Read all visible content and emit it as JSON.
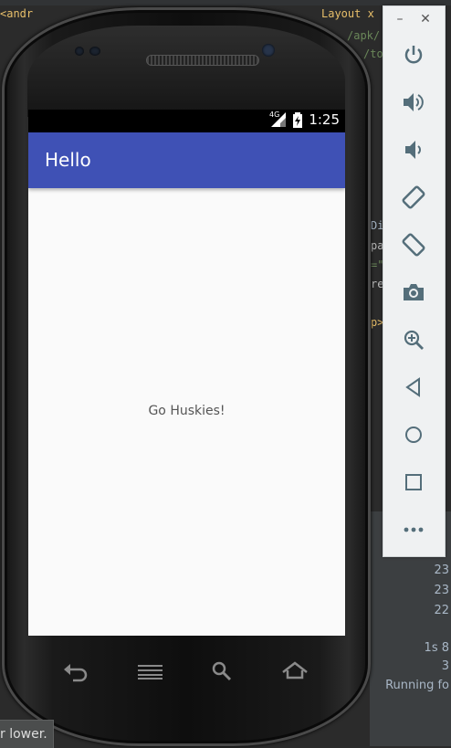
{
  "ide": {
    "code_line_1": "<andr",
    "code_line_1b": "Layout x",
    "code_frag_apk": "/apk/",
    "code_frag_to": "/to",
    "right_frags": [
      "Di",
      "pa",
      "=\"",
      "re",
      "p>"
    ],
    "log_lines": [
      "23",
      "23",
      "22",
      "1s 8",
      "3",
      "Running fo"
    ],
    "status_tip": "r lower."
  },
  "phone": {
    "status_bar": {
      "network": "4G",
      "time": "1:25"
    },
    "app_bar": {
      "title": "Hello"
    },
    "content": {
      "message": "Go Huskies!"
    },
    "nav_buttons": [
      "back-icon",
      "menu-icon",
      "search-icon",
      "home-icon"
    ]
  },
  "emulator_toolbar": {
    "window_controls": {
      "minimize": "–",
      "close": "✕"
    },
    "buttons": [
      "power-icon",
      "volume-up-icon",
      "volume-down-icon",
      "rotate-left-icon",
      "rotate-right-icon",
      "camera-icon",
      "zoom-icon",
      "back-icon",
      "home-icon",
      "overview-icon",
      "more-icon"
    ]
  }
}
